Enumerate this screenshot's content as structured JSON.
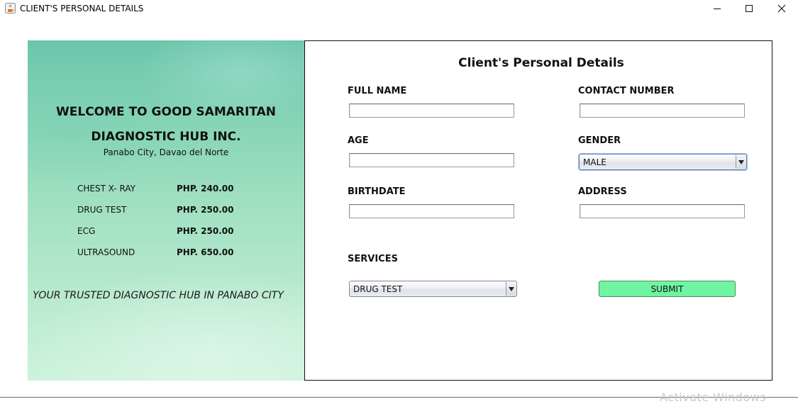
{
  "window": {
    "title": "CLIENT'S PERSONAL DETAILS",
    "icon": "java-cup-icon"
  },
  "promo": {
    "title_line1": "WELCOME TO GOOD SAMARITAN",
    "title_line2": "DIAGNOSTIC HUB INC.",
    "location": "Panabo City, Davao del Norte",
    "services": [
      {
        "name": "CHEST X- RAY",
        "price": "PHP. 240.00"
      },
      {
        "name": "DRUG TEST",
        "price": "PHP. 250.00"
      },
      {
        "name": "ECG",
        "price": "PHP. 250.00"
      },
      {
        "name": "ULTRASOUND",
        "price": "PHP. 650.00"
      }
    ],
    "tagline": "YOUR TRUSTED DIAGNOSTIC HUB IN PANABO CITY"
  },
  "form": {
    "title": "Client's Personal Details",
    "full_name": {
      "label": "FULL NAME",
      "value": ""
    },
    "contact_number": {
      "label": "CONTACT NUMBER",
      "value": ""
    },
    "age": {
      "label": "AGE",
      "value": ""
    },
    "gender": {
      "label": "GENDER",
      "selected": "MALE"
    },
    "birthdate": {
      "label": "BIRTHDATE",
      "value": ""
    },
    "address": {
      "label": "ADDRESS",
      "value": ""
    },
    "services": {
      "label": "SERVICES",
      "selected": "DRUG TEST"
    },
    "submit_label": "SUBMIT"
  },
  "watermark": "Activate Windows",
  "colors": {
    "promo_top": "#6cc6ab",
    "promo_bottom": "#cdf3dc",
    "submit_bg": "#6ff5a1"
  }
}
